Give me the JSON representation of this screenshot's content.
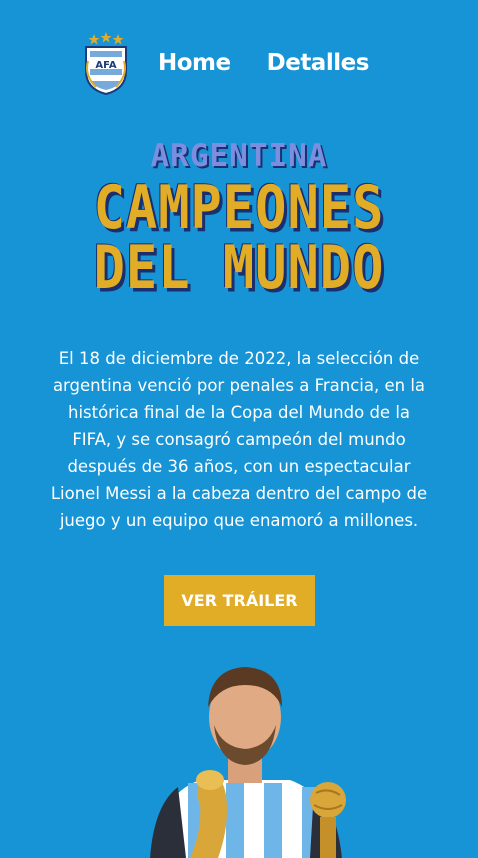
{
  "nav": {
    "logo_icon": "afa-crest-icon",
    "logo_text": "AFA",
    "items": [
      {
        "label": "Home"
      },
      {
        "label": "Detalles"
      }
    ]
  },
  "hero": {
    "title_top": "ARGENTINA",
    "title_line1": "CAMPEONES",
    "title_line2": "DEL MUNDO",
    "description": "El 18 de diciembre de 2022, la selección de argentina venció por penales a Francia, en la histórica final de la Copa del Mundo de la FIFA, y se consagró campeón del mundo después de 36 años, con un espectacular Lionel Messi a la cabeza dentro del campo de juego y un equipo que enamoró a millones.",
    "cta_label": "VER TRÁILER",
    "image_icon": "player-with-trophy-illustration"
  },
  "colors": {
    "background": "#1694d6",
    "accent": "#e2ad26",
    "title_small": "#7a8fe0",
    "text": "#ffffff"
  }
}
